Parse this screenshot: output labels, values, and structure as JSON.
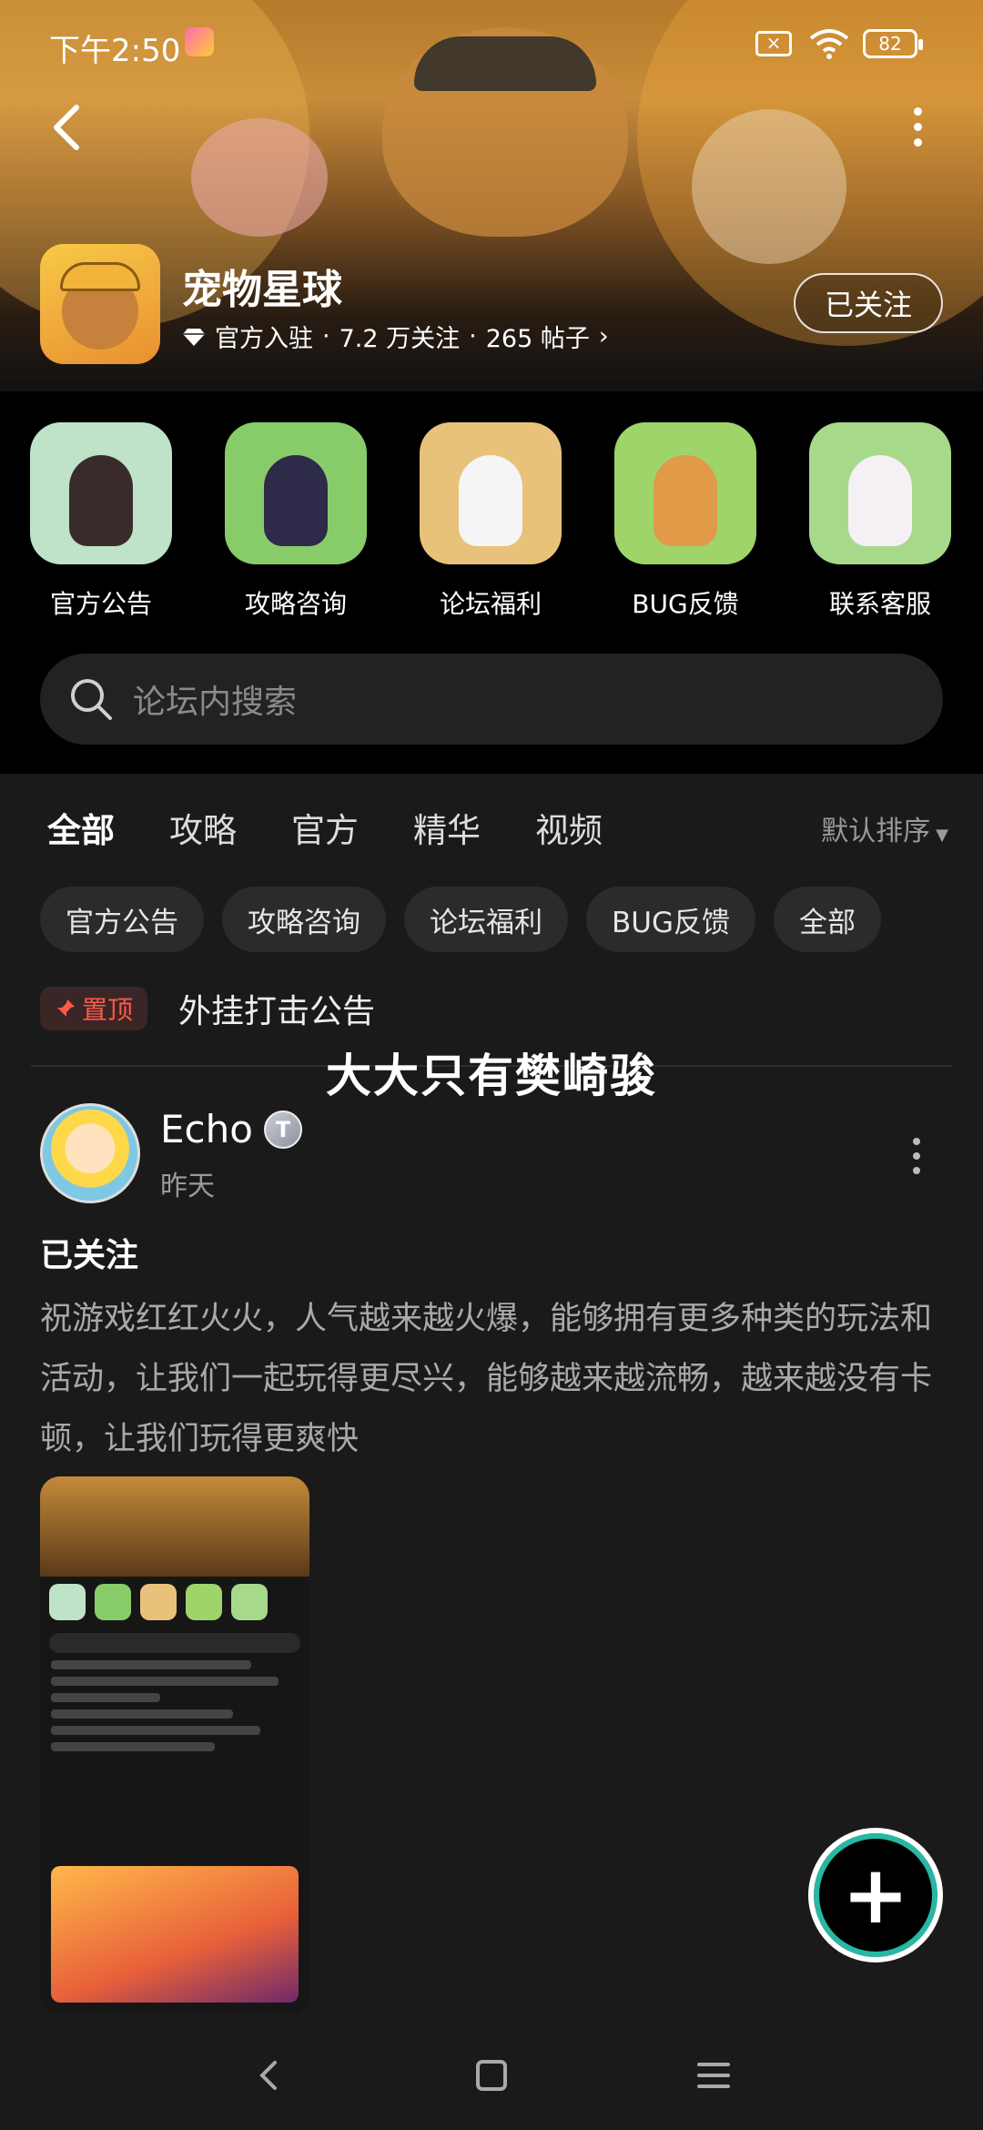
{
  "status_bar": {
    "time": "下午2:50",
    "battery": "82"
  },
  "header": {
    "game_name": "宠物星球",
    "official_label": "官方入驻",
    "followers": "7.2 万关注",
    "posts": "265 帖子",
    "follow_button": "已关注"
  },
  "quick_entries": [
    {
      "label": "官方公告",
      "color": "#bfe3c8"
    },
    {
      "label": "攻略咨询",
      "color": "#88cc6a"
    },
    {
      "label": "论坛福利",
      "color": "#e8c27a"
    },
    {
      "label": "BUG反馈",
      "color": "#9fd46a"
    },
    {
      "label": "联系客服",
      "color": "#a7d98a"
    }
  ],
  "search": {
    "placeholder": "论坛内搜索"
  },
  "tabs": [
    "全部",
    "攻略",
    "官方",
    "精华",
    "视频"
  ],
  "sort_label": "默认排序",
  "chips": [
    "官方公告",
    "攻略咨询",
    "论坛福利",
    "BUG反馈",
    "全部"
  ],
  "pinned": {
    "badge": "置顶",
    "title": "外挂打击公告"
  },
  "overlay_caption": "大大只有樊崎骏",
  "post": {
    "author": "Echo",
    "badge": "T",
    "time": "昨天",
    "title": "已关注",
    "body": "祝游戏红红火火，人气越来越火爆，能够拥有更多种类的玩法和活动，让我们一起玩得更尽兴，能够越来越流畅，越来越没有卡顿，让我们玩得更爽快"
  },
  "accent_color": "#26b8a4"
}
